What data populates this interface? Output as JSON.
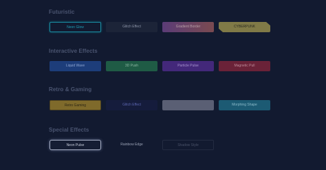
{
  "sections": [
    {
      "title": "Futuristic",
      "buttons": [
        "Neon Glow",
        "Glitch Effect",
        "Gradient Border",
        "CYBERPUNK"
      ]
    },
    {
      "title": "Interactive Effects",
      "buttons": [
        "Liquid Wave",
        "3D Push",
        "Particle Pulse",
        "Magnetic Pull"
      ]
    },
    {
      "title": "Retro & Gaming",
      "buttons": [
        "Retro Gaming",
        "Glitch Effect",
        "",
        "Morphing Shape"
      ]
    },
    {
      "title": "Special Effects",
      "buttons": [
        "Neon Pulse",
        "Rainbow Edge",
        "Shadow Style"
      ]
    }
  ]
}
